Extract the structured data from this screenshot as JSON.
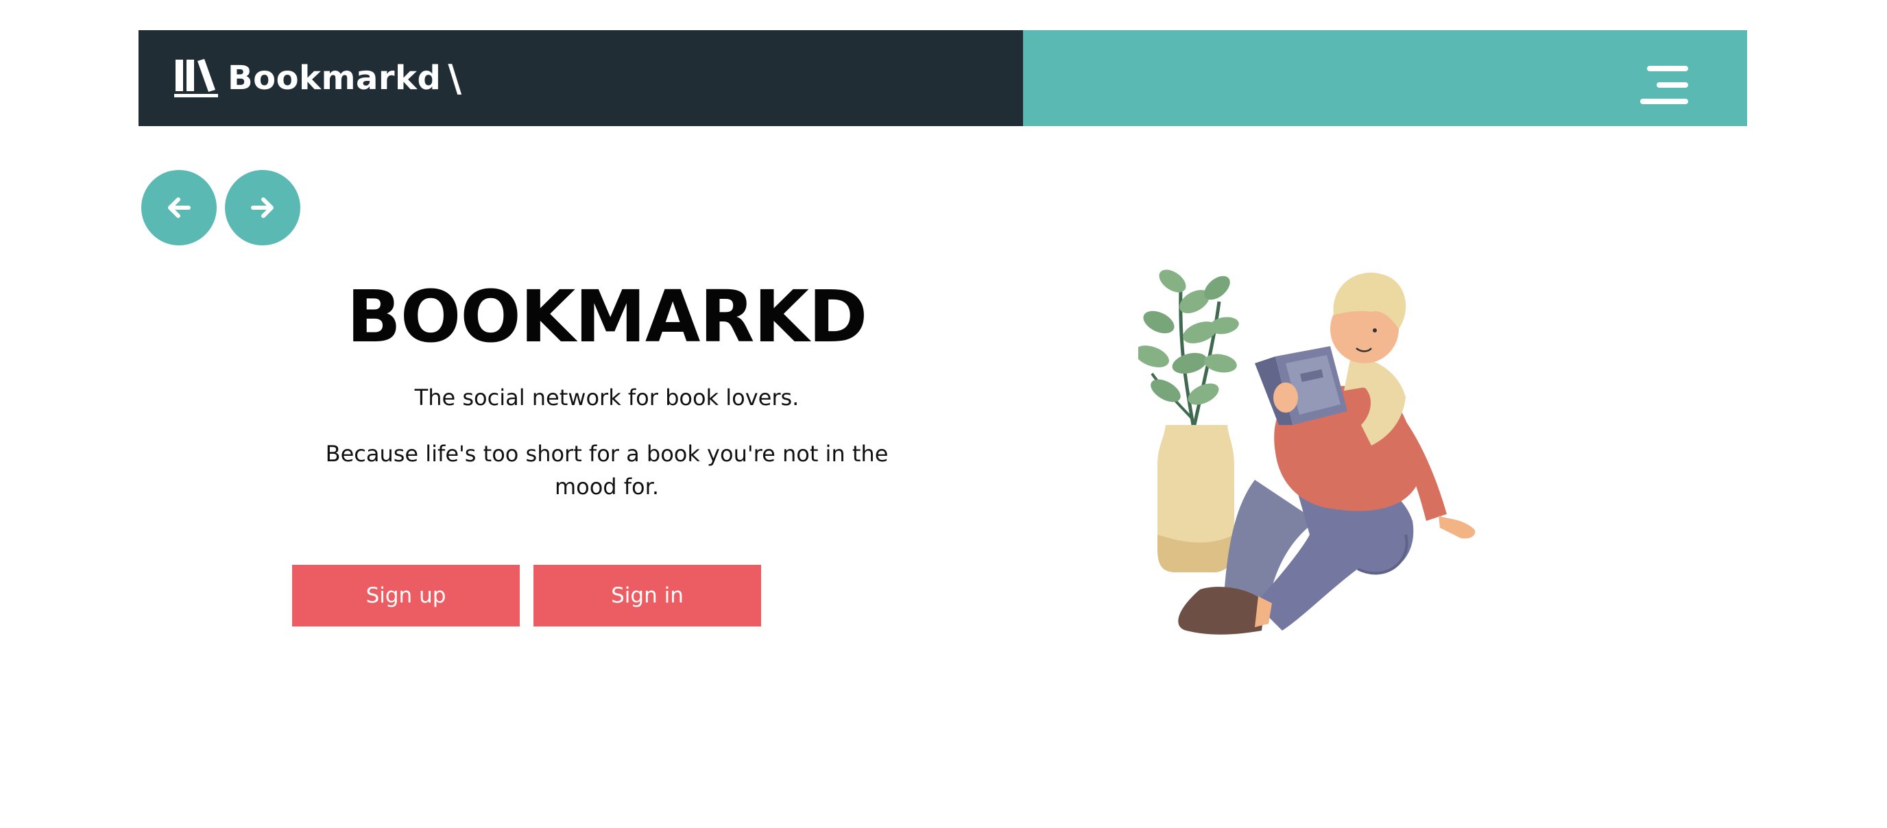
{
  "colors": {
    "header_dark": "#212d35",
    "accent_teal": "#5ab9b3",
    "cta_red": "#ec5d63",
    "text_dark": "#050505"
  },
  "header": {
    "brand_name": "Bookmarkd",
    "brand_slash": "\\",
    "brand_icon": "books-icon",
    "menu_icon": "hamburger-menu-icon"
  },
  "nav": {
    "prev_icon": "arrow-left-icon",
    "next_icon": "arrow-right-icon"
  },
  "hero": {
    "title": "BOOKMARKD",
    "tagline": "The social network for book lovers.",
    "subtitle": "Because life's too short for a book you're not in the mood for."
  },
  "buttons": {
    "signup_label": "Sign up",
    "signin_label": "Sign in"
  },
  "illustration": {
    "icon": "person-reading-illustration"
  }
}
